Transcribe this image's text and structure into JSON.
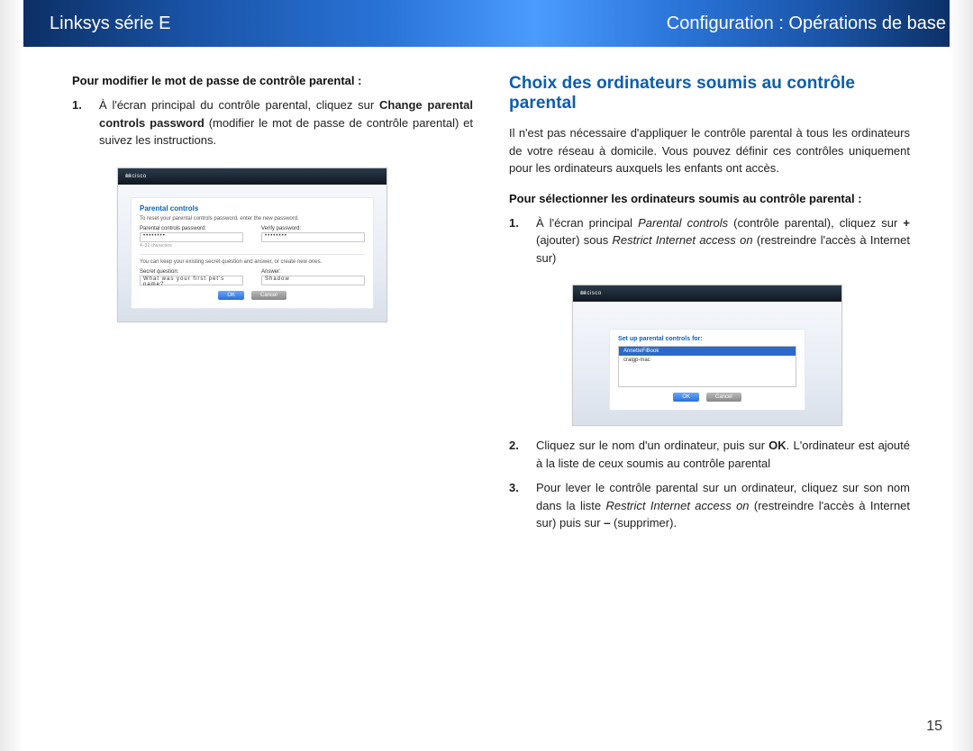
{
  "header": {
    "left": "Linksys série E",
    "right": "Configuration : Opérations de base"
  },
  "left": {
    "heading": "Pour modifier le mot de passe de contrôle parental :",
    "step1_pre": "À l'écran principal du contrôle parental, cliquez sur ",
    "step1_bold": "Change parental controls password",
    "step1_post": " (modifier le mot de passe de contrôle parental) et suivez les instructions."
  },
  "right": {
    "title": "Choix des ordinateurs soumis au contrôle parental",
    "intro": "Il n'est pas nécessaire d'appliquer le contrôle parental à tous les ordinateurs de votre réseau à domicile. Vous pouvez définir ces contrôles uniquement pour les ordinateurs auxquels les enfants ont accès.",
    "heading2": "Pour sélectionner les ordinateurs soumis au contrôle parental :",
    "s1_a": "À l'écran principal ",
    "s1_i1": "Parental controls",
    "s1_b": " (contrôle parental), cliquez sur ",
    "s1_bold_plus": "+",
    "s1_c": " (ajouter) sous ",
    "s1_i2": "Restrict Internet access on",
    "s1_d": " (restreindre l'accès à Internet sur)",
    "s2_a": "Cliquez sur le nom d'un ordinateur, puis sur ",
    "s2_bold_ok": "OK",
    "s2_b": ". L'ordinateur est ajouté à la liste de ceux soumis au contrôle parental",
    "s3_a": "Pour lever le contrôle parental sur un ordinateur, cliquez sur son nom dans la liste ",
    "s3_i": "Restrict Internet access on",
    "s3_b": " (restreindre l'accès à Internet sur) puis sur ",
    "s3_bold_minus": "–",
    "s3_c": " (supprimer)."
  },
  "fig1": {
    "logo": "cisco",
    "panel_title": "Parental controls",
    "intro": "To reset your parental controls password, enter the new password.",
    "lbl_pw": "Parental controls password:",
    "lbl_verify": "Verify password:",
    "hint": "4–32 characters",
    "note": "You can keep your existing secret question and answer, or create new ones.",
    "lbl_question": "Secret question:",
    "q_value": "What was your first pet's name?",
    "lbl_answer": "Answer:",
    "a_value": "Shadow",
    "btn_ok": "OK",
    "btn_cancel": "Cancel"
  },
  "fig2": {
    "logo": "cisco",
    "panel_title": "Set up parental controls for:",
    "item_selected": "AnnetteFiBook",
    "item_other": "craigp-mac",
    "btn_ok": "OK",
    "btn_cancel": "Cancel"
  },
  "page_number": "15"
}
